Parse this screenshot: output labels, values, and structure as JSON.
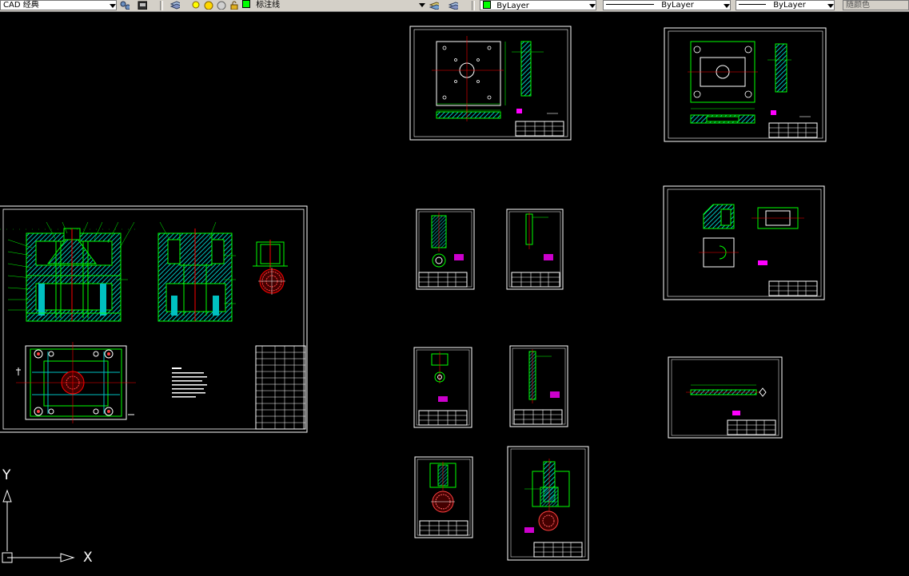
{
  "toolbar": {
    "workspace": {
      "value": "CAD 经典"
    },
    "layer": {
      "value": "标注线"
    },
    "color": {
      "value": "ByLayer",
      "swatch": "#00ff00"
    },
    "linetype": {
      "value": "ByLayer"
    },
    "lineweight": {
      "value": "ByLayer"
    },
    "plotstyle": {
      "value": "随颜色"
    }
  },
  "ucs": {
    "x_label": "X",
    "y_label": "Y"
  },
  "colors": {
    "background": "#000000",
    "sheet_border": "#ffffff",
    "geometry": "#00ff00",
    "hatch": "#00c0c0",
    "dimension": "#ff00ff",
    "centerline": "#ff0000",
    "annotation": "#ffff00"
  },
  "sheets": [
    {
      "id": "assembly",
      "kind": "assembly"
    },
    {
      "id": "top-plate",
      "kind": "plate"
    },
    {
      "id": "frame-plate",
      "kind": "frame"
    },
    {
      "id": "part-a1",
      "kind": "small"
    },
    {
      "id": "part-a2",
      "kind": "small"
    },
    {
      "id": "block-part",
      "kind": "block"
    },
    {
      "id": "part-b1",
      "kind": "small"
    },
    {
      "id": "part-b2",
      "kind": "small"
    },
    {
      "id": "long-rod",
      "kind": "rod"
    },
    {
      "id": "part-c1",
      "kind": "small"
    },
    {
      "id": "part-c2",
      "kind": "small"
    }
  ]
}
